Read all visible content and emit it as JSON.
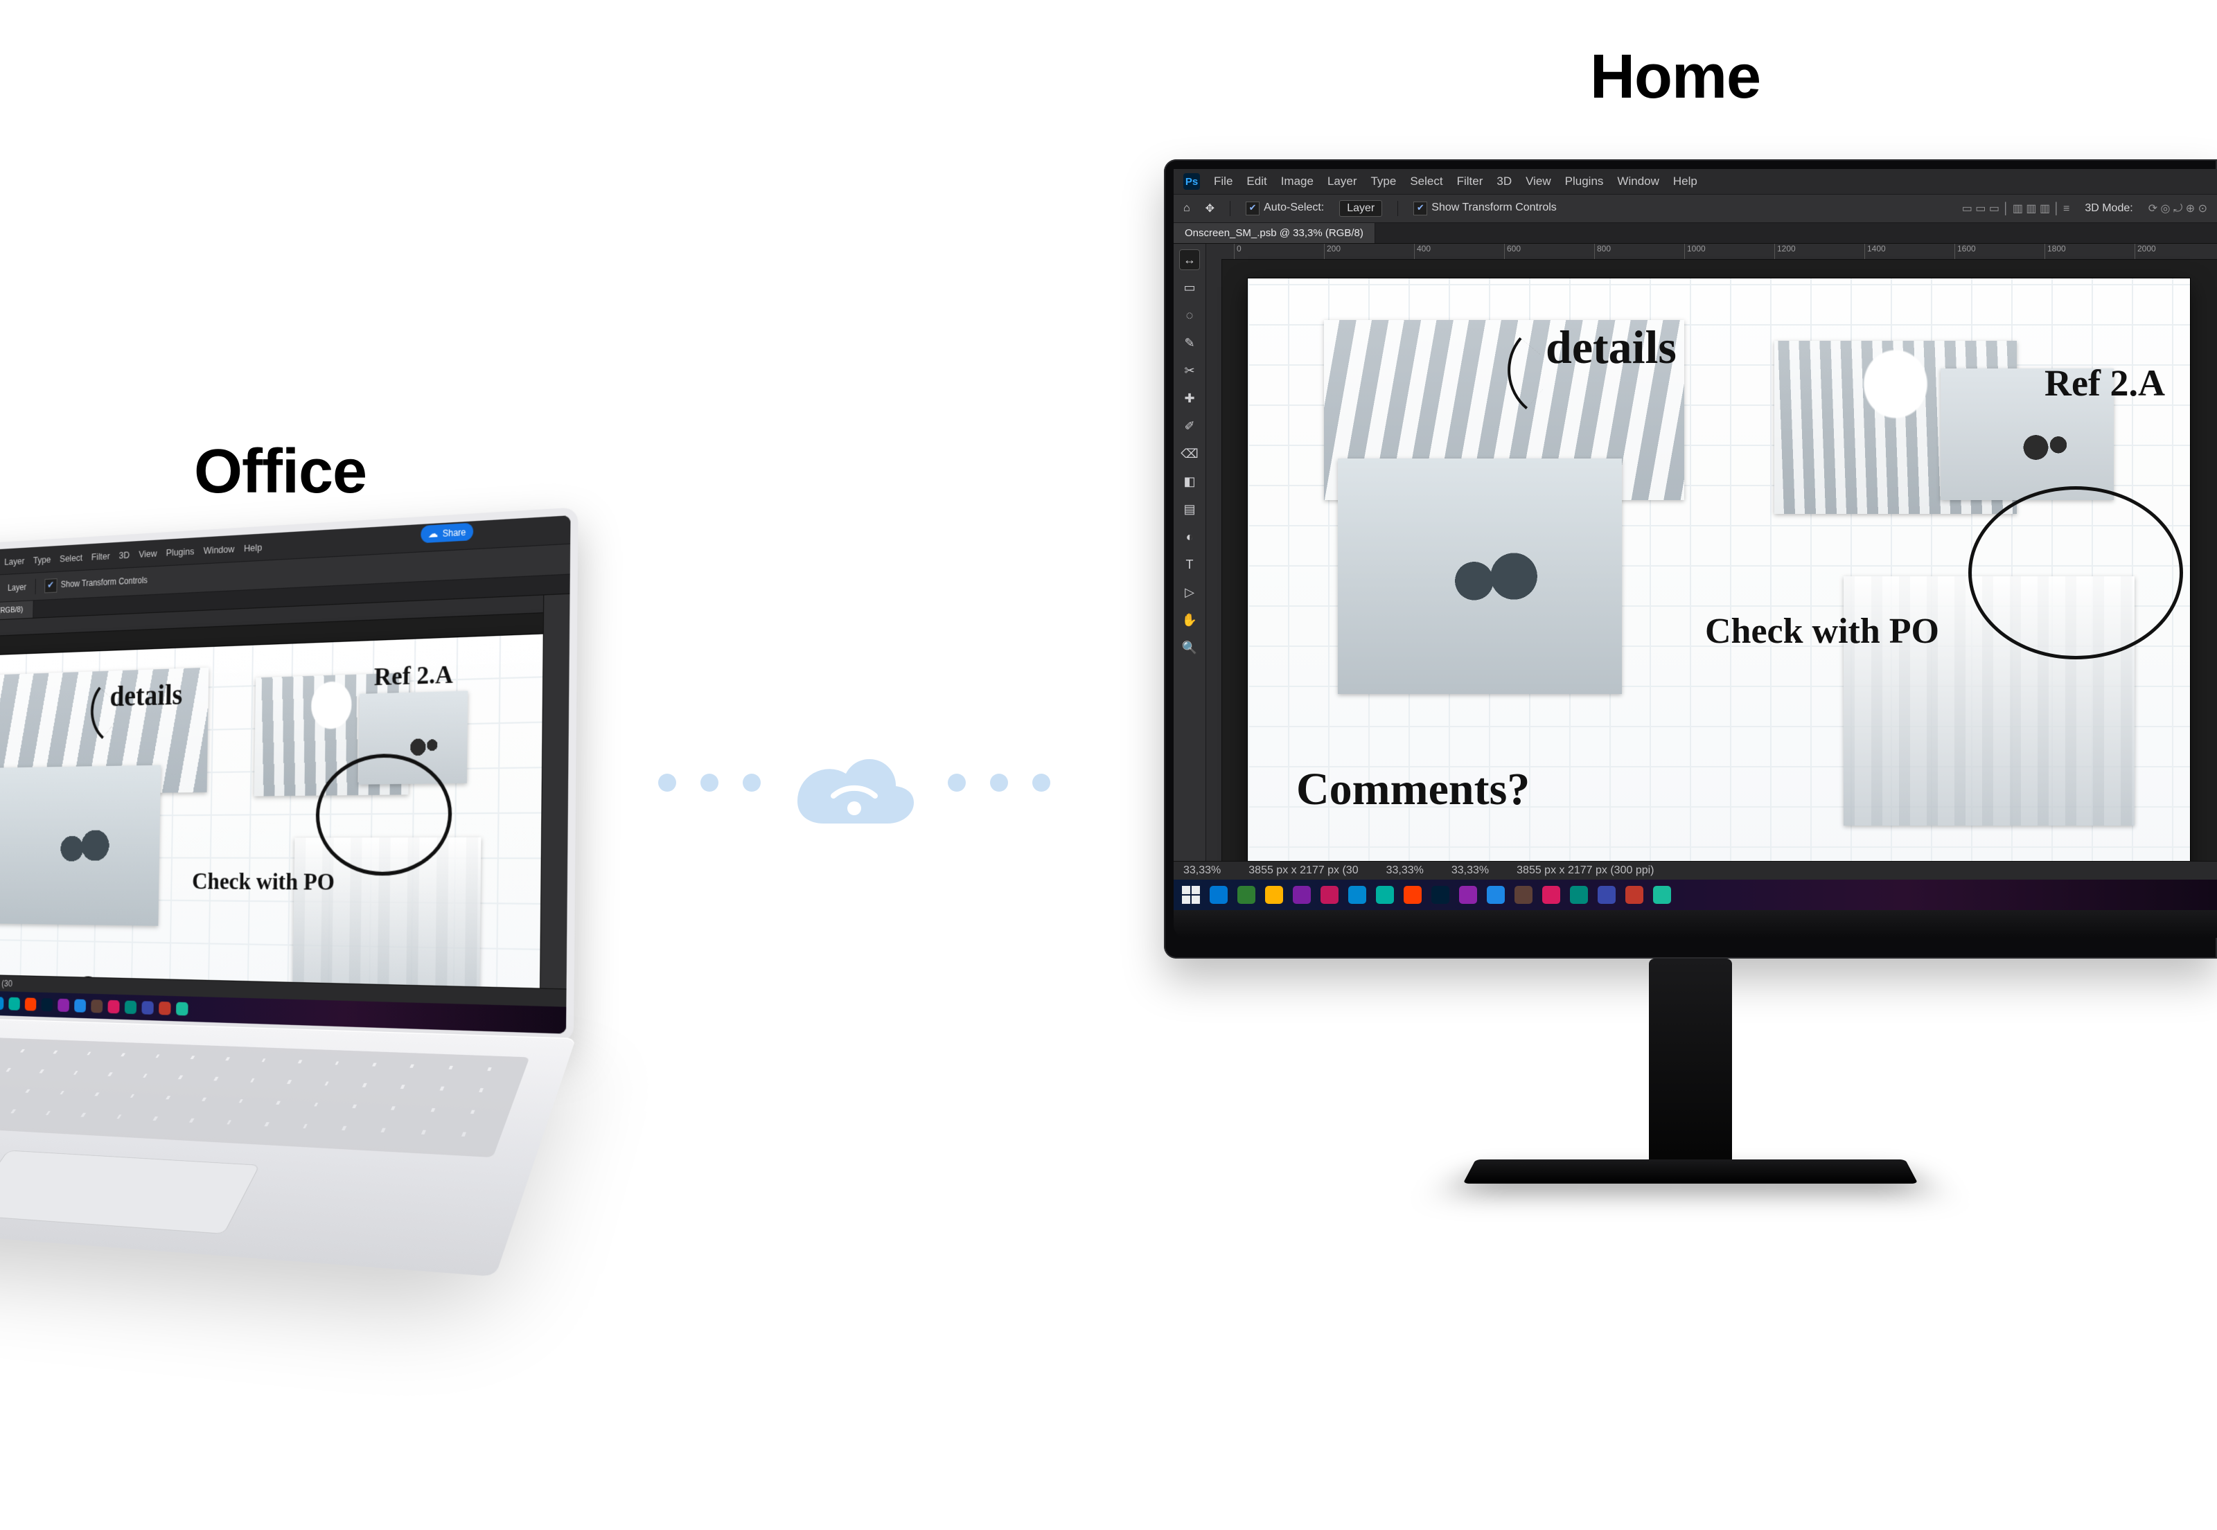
{
  "labels": {
    "office": "Office",
    "home": "Home"
  },
  "ps": {
    "menu": [
      "File",
      "Edit",
      "Image",
      "Layer",
      "Type",
      "Select",
      "Filter",
      "3D",
      "View",
      "Plugins",
      "Window",
      "Help"
    ],
    "share": "Share",
    "options": {
      "auto_select": "Auto-Select:",
      "auto_select_value": "Layer",
      "show_transform": "Show Transform Controls",
      "mode_3d": "3D Mode:"
    },
    "tab": "Onscreen_SM_.psb @ 33,3% (RGB/8)",
    "ruler_marks": [
      "0",
      "200",
      "400",
      "600",
      "800",
      "1000",
      "1200",
      "1400",
      "1600",
      "1800",
      "2000"
    ],
    "status": {
      "zoom_a": "33,33%",
      "dim_a": "3855 px x 2177 px (30",
      "zoom_b": "33,33%",
      "zoom_c": "33,33%",
      "dim_b": "3855 px x 2177 px (300 ppi)"
    },
    "tools": [
      "↔",
      "▭",
      "◌",
      "✎",
      "✂",
      "✚",
      "✐",
      "⌫",
      "◧",
      "▤",
      "◐",
      "T",
      "▷",
      "✋",
      "🔍"
    ]
  },
  "annotations": {
    "details": "details",
    "comments": "Comments?",
    "check": "Check with PO",
    "ref": "Ref 2.A"
  },
  "colors": {
    "accent_cloud": "#c9dff4",
    "ps_blue": "#31a8ff"
  },
  "taskbar_apps": [
    "#0078d4",
    "#2f7d32",
    "#ffb300",
    "#7b1fa2",
    "#c2185b",
    "#0288d1",
    "#00b0a0",
    "#ff3d00",
    "#001e36",
    "#8e24aa",
    "#1e88e5",
    "#5d4037",
    "#d81b60",
    "#00897b",
    "#3949ab",
    "#c0392b",
    "#1abc9c"
  ]
}
